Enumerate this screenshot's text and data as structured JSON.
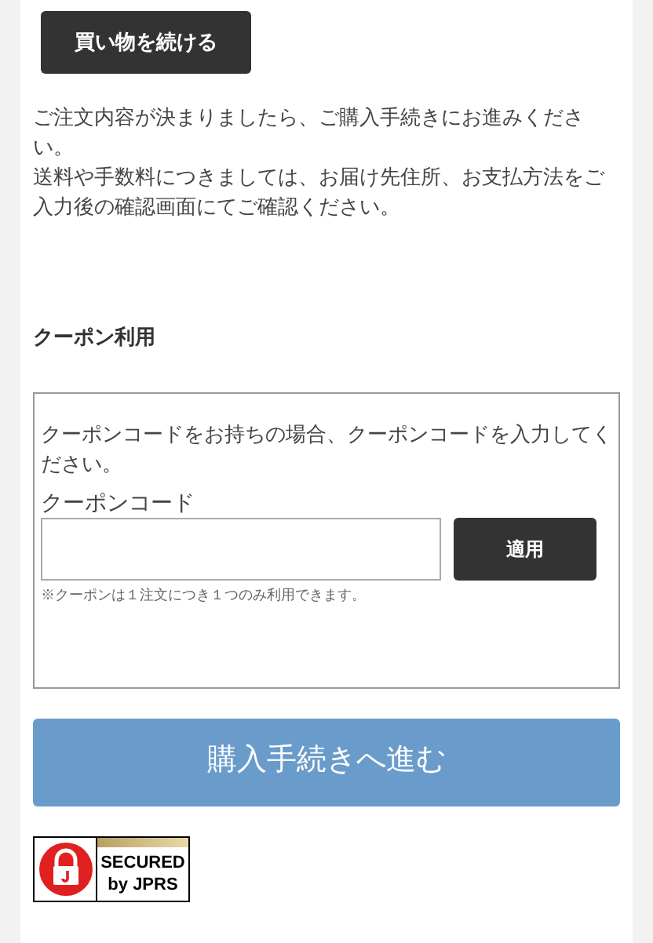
{
  "continue_button": "買い物を続ける",
  "notice": [
    "ご注文内容が決まりましたら、ご購入手続きにお進みください。",
    "送料や手数料につきましては、お届け先住所、お支払方法をご入力後の確認画面にてご確認ください。"
  ],
  "coupon": {
    "heading": "クーポン利用",
    "description": "クーポンコードをお持ちの場合、クーポンコードを入力してください。",
    "field_label": "クーポンコード",
    "apply_button": "適用",
    "note": "※クーポンは１注文につき１つのみ利用できます。"
  },
  "checkout_button": "購入手続きへ進む",
  "seal": {
    "line_1": "SECURED",
    "line_2": "by JPRS"
  }
}
